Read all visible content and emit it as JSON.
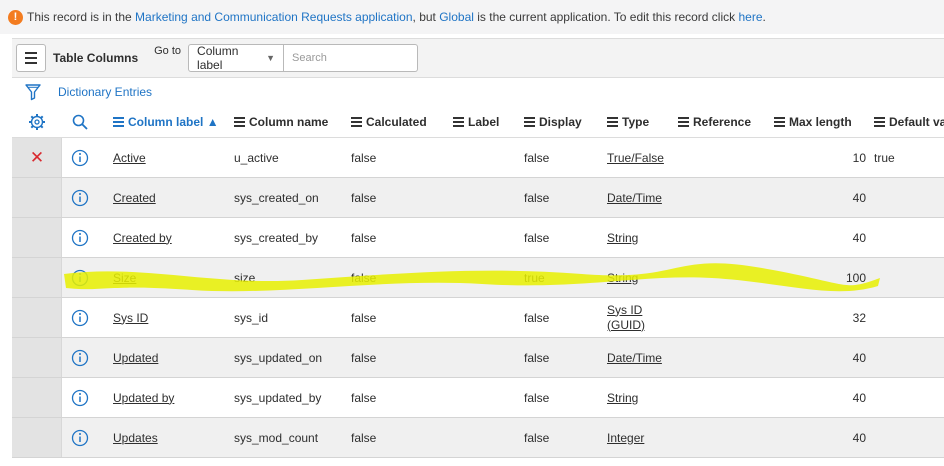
{
  "notice": {
    "icon": "exclamation-icon",
    "prefix": "This record is in the ",
    "app_link": "Marketing and Communication Requests application",
    "middle": ", but ",
    "scope_link": "Global",
    "suffix": " is the current application. To edit this record click ",
    "here_link": "here",
    "end": "."
  },
  "toolbar": {
    "menu_icon": "hamburger-icon",
    "title": "Table Columns",
    "goto_label": "Go to",
    "goto_value": "Column label",
    "search_placeholder": "Search"
  },
  "dictionary": {
    "filter_icon": "funnel-icon",
    "label": "Dictionary Entries"
  },
  "header": {
    "settings_icon": "gear-icon",
    "search_icon": "search-icon",
    "columns": [
      "Column label",
      "Column name",
      "Calculated",
      "Label",
      "Display",
      "Type",
      "Reference",
      "Max length",
      "Default val"
    ],
    "sort_indicator": "▲"
  },
  "rows": [
    {
      "delete": "✕",
      "label": "Active",
      "name": "u_active",
      "calculated": "false",
      "display": "false",
      "type": "True/False",
      "max": "10",
      "default": "true"
    },
    {
      "delete": "",
      "label": "Created",
      "name": "sys_created_on",
      "calculated": "false",
      "display": "false",
      "type": "Date/Time",
      "max": "40",
      "default": ""
    },
    {
      "delete": "",
      "label": "Created by",
      "name": "sys_created_by",
      "calculated": "false",
      "display": "false",
      "type": "String",
      "max": "40",
      "default": ""
    },
    {
      "delete": "",
      "label": "Size",
      "name": "size",
      "calculated": "false",
      "display": "true",
      "type": "String",
      "max": "100",
      "default": ""
    },
    {
      "delete": "",
      "label": "Sys ID",
      "name": "sys_id",
      "calculated": "false",
      "display": "false",
      "type": "Sys ID (GUID)",
      "type_line1": "Sys ID",
      "type_line2": "(GUID)",
      "max": "32",
      "default": ""
    },
    {
      "delete": "",
      "label": "Updated",
      "name": "sys_updated_on",
      "calculated": "false",
      "display": "false",
      "type": "Date/Time",
      "max": "40",
      "default": ""
    },
    {
      "delete": "",
      "label": "Updated by",
      "name": "sys_updated_by",
      "calculated": "false",
      "display": "false",
      "type": "String",
      "max": "40",
      "default": ""
    },
    {
      "delete": "",
      "label": "Updates",
      "name": "sys_mod_count",
      "calculated": "false",
      "display": "false",
      "type": "Integer",
      "max": "40",
      "default": ""
    }
  ],
  "colors": {
    "link": "#1f74c5",
    "warning": "#f37c20",
    "delete": "#d9292f",
    "highlight": "#e8f000"
  }
}
